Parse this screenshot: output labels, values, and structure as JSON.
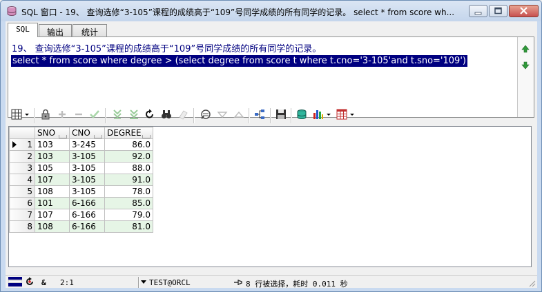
{
  "window": {
    "title": "SQL 窗口 - 19、 查询选修“3-105”课程的成绩高于“109”号同学成绩的所有同学的记录。 select * from score wh..."
  },
  "tabs": [
    {
      "label": "SQL",
      "active": true
    },
    {
      "label": "输出",
      "active": false
    },
    {
      "label": "统计",
      "active": false
    }
  ],
  "editor": {
    "comment_line": "19、 查询选修“3-105”课程的成绩高于“109”号同学成绩的所有同学的记录。",
    "query_line": "select * from score where degree > (select degree from score t where t.cno='3-105'and t.sno='109')"
  },
  "grid": {
    "columns": [
      "SNO",
      "CNO",
      "DEGREE"
    ],
    "rows": [
      {
        "n": "1",
        "sno": "103",
        "cno": "3-245",
        "degree": "86.0"
      },
      {
        "n": "2",
        "sno": "103",
        "cno": "3-105",
        "degree": "92.0"
      },
      {
        "n": "3",
        "sno": "105",
        "cno": "3-105",
        "degree": "88.0"
      },
      {
        "n": "4",
        "sno": "107",
        "cno": "3-105",
        "degree": "91.0"
      },
      {
        "n": "5",
        "sno": "108",
        "cno": "3-105",
        "degree": "78.0"
      },
      {
        "n": "6",
        "sno": "101",
        "cno": "6-166",
        "degree": "85.0"
      },
      {
        "n": "7",
        "sno": "107",
        "cno": "6-166",
        "degree": "79.0"
      },
      {
        "n": "8",
        "sno": "108",
        "cno": "6-166",
        "degree": "81.0"
      }
    ]
  },
  "status": {
    "position": "2:1",
    "ampersand": "&",
    "connection": "TEST@ORCL",
    "message": "8 行被选择，耗时 0.011 秒"
  },
  "colors": {
    "selection": "#000080",
    "alt_row": "#e6f5e6"
  }
}
